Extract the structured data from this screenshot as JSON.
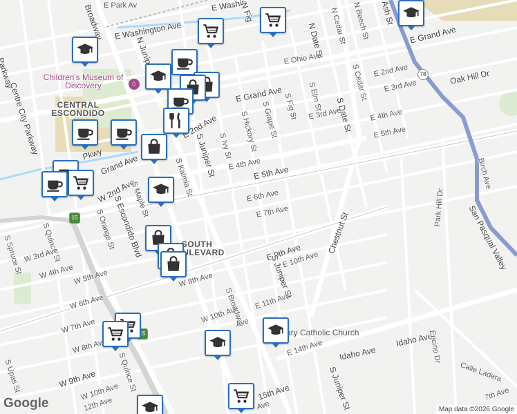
{
  "labels": {
    "streets": [
      {
        "id": "e-park-av",
        "text": "E Park Av"
      },
      {
        "id": "e-washington-ave",
        "text": "E Washington Ave"
      },
      {
        "id": "e-washington-ave-2",
        "text": "E Washin"
      },
      {
        "id": "broadway-n",
        "text": "Broadway"
      },
      {
        "id": "n-fig",
        "text": "N Fig"
      },
      {
        "id": "n-juniper",
        "text": "N Juniper"
      },
      {
        "id": "n-date-st",
        "text": "N Date St"
      },
      {
        "id": "n-cedar-st",
        "text": "N Cedar St"
      },
      {
        "id": "n-beech-st",
        "text": "N Beech St"
      },
      {
        "id": "n-ash-st",
        "text": "Ash St"
      },
      {
        "id": "e-grand-ave-ne",
        "text": "E Grand Ave"
      },
      {
        "id": "e-ohio-ave",
        "text": "E Ohio Ave"
      },
      {
        "id": "e-2nd-ave-ne",
        "text": "E 2nd Ave"
      },
      {
        "id": "s-cedar-st",
        "text": "S Cedar St"
      },
      {
        "id": "e-3rd-ave-ne",
        "text": "E 3rd Ave"
      },
      {
        "id": "oak-hill-dr",
        "text": "Oak Hill Dr"
      },
      {
        "id": "e-grand-ave",
        "text": "E Grand Ave"
      },
      {
        "id": "s-fig-st",
        "text": "S Fig St"
      },
      {
        "id": "s-elm-st",
        "text": "S Elm St"
      },
      {
        "id": "s-date-st",
        "text": "S Date St"
      },
      {
        "id": "e-3rd-ave",
        "text": "E 3rd Ave"
      },
      {
        "id": "e-4th-ave-e",
        "text": "E 4th Ave"
      },
      {
        "id": "e-5th-ave-e",
        "text": "E 5th Ave"
      },
      {
        "id": "s-grape-st",
        "text": "S Grape St"
      },
      {
        "id": "s-hickory-st",
        "text": "S Hickory St"
      },
      {
        "id": "s-ivy-st",
        "text": "S Ivy St"
      },
      {
        "id": "s-juniper-st",
        "text": "S Juniper St"
      },
      {
        "id": "e-2nd-ave",
        "text": "E 2nd Ave"
      },
      {
        "id": "e-4th-ave",
        "text": "E 4th Ave"
      },
      {
        "id": "e-5th-ave",
        "text": "E 5th Ave"
      },
      {
        "id": "e-6th-ave",
        "text": "E 6th Ave"
      },
      {
        "id": "e-7th-ave",
        "text": "E 7th Ave"
      },
      {
        "id": "chestnut-st",
        "text": "Chestnut St"
      },
      {
        "id": "birch-ave",
        "text": "Birch Ave"
      },
      {
        "id": "park-hill-dr",
        "text": "Park Hill Dr"
      },
      {
        "id": "san-pasqual-valley",
        "text": "San Pasqual Valley"
      },
      {
        "id": "parkway",
        "text": "Parkway"
      },
      {
        "id": "centre-city-parkway",
        "text": "Centre City Parkway"
      },
      {
        "id": "pkwy",
        "text": "Pkwy"
      },
      {
        "id": "w-grand-ave",
        "text": "Grand Ave"
      },
      {
        "id": "w-2nd-ave",
        "text": "W 2nd Ave"
      },
      {
        "id": "s-maple-st",
        "text": "S Maple St"
      },
      {
        "id": "s-kalmia-st",
        "text": "S Kalmia St"
      },
      {
        "id": "s-escondido-blvd",
        "text": "S Escondido Blvd"
      },
      {
        "id": "s-orange-st",
        "text": "S Orange St"
      },
      {
        "id": "s-quince-st",
        "text": "S Quince St"
      },
      {
        "id": "s-spruce-st",
        "text": "S Spruce St"
      },
      {
        "id": "w-3rd-ave",
        "text": "W 3rd Ave"
      },
      {
        "id": "w-4th-ave",
        "text": "W 4th Ave"
      },
      {
        "id": "w-5th-ave",
        "text": "W 5th Ave"
      },
      {
        "id": "w-6th-ave",
        "text": "W 6th Ave"
      },
      {
        "id": "w-7th-ave",
        "text": "W 7th Ave"
      },
      {
        "id": "w-8th-ave",
        "text": "W 8th Ave"
      },
      {
        "id": "w-8th-ave-2",
        "text": "W 8th Ave"
      },
      {
        "id": "w-9th-ave",
        "text": "W 9th Ave"
      },
      {
        "id": "w-10th-ave",
        "text": "W 10th Ave"
      },
      {
        "id": "w-10th-ave-2",
        "text": "W 10th Ave"
      },
      {
        "id": "s-quince-st-2",
        "text": "S Quince St"
      },
      {
        "id": "s-upas-st",
        "text": "S Upas St"
      },
      {
        "id": "e-9th-ave",
        "text": "E 9th Ave"
      },
      {
        "id": "e-10th-ave",
        "text": "E 10th Ave"
      },
      {
        "id": "e-11th-ave",
        "text": "E 11th Ave"
      },
      {
        "id": "s-juniper-st-2",
        "text": "S Juniper St"
      },
      {
        "id": "s-broadway",
        "text": "S Broadway"
      },
      {
        "id": "ave-fragment",
        "text": "Ave"
      },
      {
        "id": "e-14th-ave",
        "text": "E 14th Ave"
      },
      {
        "id": "idaho-ave",
        "text": "Idaho Ave"
      },
      {
        "id": "idaho-ave-2",
        "text": "Idaho Ave"
      },
      {
        "id": "encino-dr",
        "text": "Encino Dr"
      },
      {
        "id": "calle-ladera",
        "text": "Calle Ladera"
      },
      {
        "id": "s-juniper-st-3",
        "text": "S Juniper St"
      },
      {
        "id": "e-15th-ave",
        "text": "15th Ave"
      },
      {
        "id": "s-ave-fragment",
        "text": "Ave"
      },
      {
        "id": "e-17th-ave",
        "text": "7th Ave"
      },
      {
        "id": "w-12th-ave",
        "text": "12th Ave"
      }
    ],
    "areas": [
      {
        "id": "central-escondido",
        "text": "CENTRAL ESCONDIDO"
      },
      {
        "id": "south-boulevard",
        "text": "SOUTH BOULEVARD"
      },
      {
        "id": "escondido-fragment",
        "text": "E"
      }
    ],
    "poi": [
      {
        "id": "childrens-museum",
        "text": "Children's Museum of Discovery"
      },
      {
        "id": "st-mary",
        "text": "St. Mary Catholic Church"
      }
    ],
    "shields": [
      {
        "id": "hwy-78",
        "text": "78"
      },
      {
        "id": "hwy-15-a",
        "text": "15"
      },
      {
        "id": "hwy-15-b",
        "text": "15"
      }
    ]
  },
  "pins": [
    {
      "id": "pin-grocery-nfig",
      "icon": "shopping-cart-icon"
    },
    {
      "id": "pin-grocery-washington",
      "icon": "shopping-cart-icon"
    },
    {
      "id": "pin-school-nw",
      "icon": "graduation-cap-icon"
    },
    {
      "id": "pin-school-ne",
      "icon": "graduation-cap-icon"
    },
    {
      "id": "pin-cafe-juniper",
      "icon": "coffee-cup-icon"
    },
    {
      "id": "pin-school-museum",
      "icon": "graduation-cap-icon"
    },
    {
      "id": "pin-shop-stack-1",
      "icon": "shopping-bag-icon"
    },
    {
      "id": "pin-shop-stack-2",
      "icon": "shopping-bag-icon"
    },
    {
      "id": "pin-cafe-stack",
      "icon": "coffee-cup-icon"
    },
    {
      "id": "pin-restaurant",
      "icon": "fork-knife-icon"
    },
    {
      "id": "pin-cafe-west",
      "icon": "coffee-cup-icon"
    },
    {
      "id": "pin-cafe-central",
      "icon": "coffee-cup-icon"
    },
    {
      "id": "pin-shop-2nd",
      "icon": "shopping-bag-icon"
    },
    {
      "id": "pin-cafe-grand",
      "icon": "coffee-cup-icon"
    },
    {
      "id": "pin-grocery-grand",
      "icon": "shopping-cart-icon"
    },
    {
      "id": "pin-cafe-grand-2",
      "icon": "coffee-cup-icon"
    },
    {
      "id": "pin-school-maple",
      "icon": "graduation-cap-icon"
    },
    {
      "id": "pin-shop-escondido-1",
      "icon": "shopping-bag-icon"
    },
    {
      "id": "pin-shop-escondido-2",
      "icon": "shopping-bag-icon"
    },
    {
      "id": "pin-shop-escondido-3",
      "icon": "shopping-bag-icon"
    },
    {
      "id": "pin-grocery-7th-a",
      "icon": "shopping-cart-icon"
    },
    {
      "id": "pin-grocery-7th-b",
      "icon": "shopping-cart-icon"
    },
    {
      "id": "pin-school-stmary",
      "icon": "graduation-cap-icon"
    },
    {
      "id": "pin-school-broadway",
      "icon": "graduation-cap-icon"
    },
    {
      "id": "pin-grocery-15th",
      "icon": "shopping-cart-icon"
    },
    {
      "id": "pin-school-south",
      "icon": "graduation-cap-icon"
    }
  ],
  "footer": {
    "logo": "Google",
    "attribution": "Map data ©2026 Google"
  }
}
